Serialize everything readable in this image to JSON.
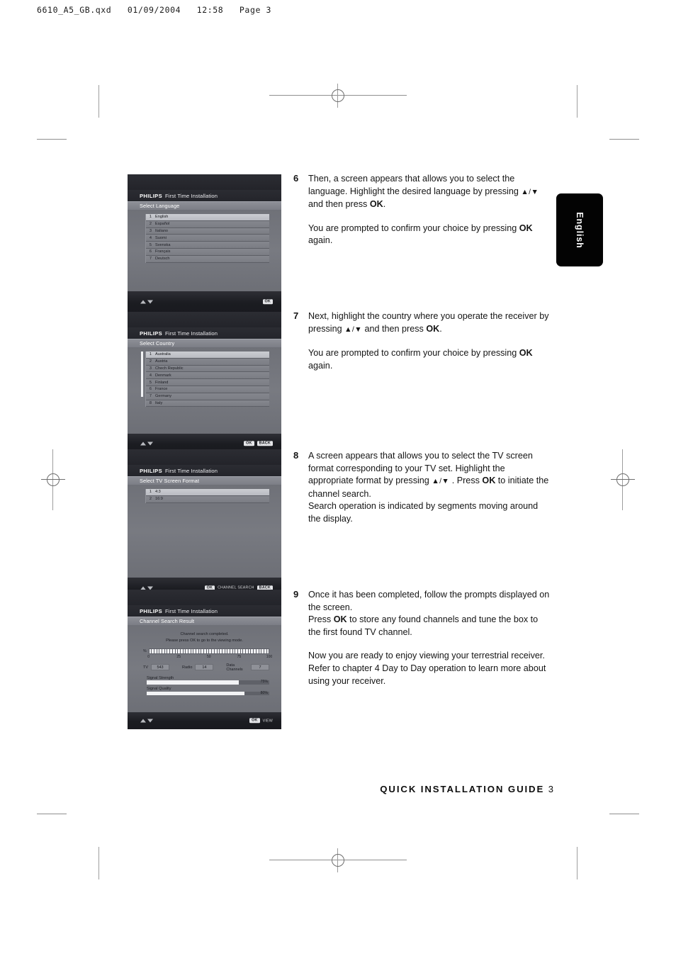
{
  "prepress": {
    "header": "6610_A5_GB.qxd   01/09/2004   12:58   Page 3"
  },
  "side_tab": {
    "label": "English"
  },
  "footer": {
    "title": "QUICK INSTALLATION GUIDE",
    "page": "3"
  },
  "brand": {
    "logo": "PHILIPS",
    "window_title": "First Time Installation"
  },
  "colors": {
    "panel_dark": "#1c1d22",
    "panel_body": "#74767d",
    "subbar": "#84868d",
    "selected_row": "#c5c7cc",
    "badge": "#e4e5e8",
    "tab_black": "#030303"
  },
  "screens": [
    {
      "name": "select-language",
      "subtitle": "Select Language",
      "selected_index": 0,
      "rows": [
        {
          "num": "1",
          "label": "English"
        },
        {
          "num": "2",
          "label": "Español"
        },
        {
          "num": "3",
          "label": "Italiano"
        },
        {
          "num": "4",
          "label": "Suomi"
        },
        {
          "num": "5",
          "label": "Svenska"
        },
        {
          "num": "6",
          "label": "Français"
        },
        {
          "num": "7",
          "label": "Deutsch"
        }
      ],
      "actions": [
        {
          "badge": "OK",
          "text": ""
        }
      ]
    },
    {
      "name": "select-country",
      "subtitle": "Select Country",
      "selected_index": 0,
      "rows": [
        {
          "num": "1",
          "label": "Australia"
        },
        {
          "num": "2",
          "label": "Austria"
        },
        {
          "num": "3",
          "label": "Chech Republic"
        },
        {
          "num": "4",
          "label": "Denmark"
        },
        {
          "num": "5",
          "label": "Finland"
        },
        {
          "num": "6",
          "label": "France"
        },
        {
          "num": "7",
          "label": "Germany"
        },
        {
          "num": "8",
          "label": "Italy"
        }
      ],
      "actions": [
        {
          "badge": "OK",
          "text": ""
        },
        {
          "badge": "BACK",
          "text": ""
        }
      ]
    },
    {
      "name": "select-tv-screen-format",
      "subtitle": "Select TV Screen Format",
      "selected_index": 0,
      "rows": [
        {
          "num": "1",
          "label": "4:3"
        },
        {
          "num": "2",
          "label": "16:9"
        }
      ],
      "actions": [
        {
          "badge": "OK",
          "text": "CHANNEL SEARCH"
        },
        {
          "badge": "BACK",
          "text": ""
        }
      ]
    }
  ],
  "search_result": {
    "name": "channel-search-result",
    "subtitle": "Channel Search Result",
    "message_line1": "Channel search completed.",
    "message_line2": "Please press OK to go to the viewing mode.",
    "progress": {
      "unit": "%",
      "value": 100,
      "segments": 46,
      "scale": [
        "0",
        "25",
        "50",
        "75",
        "100"
      ]
    },
    "counts": [
      {
        "label": "TV",
        "value": "543"
      },
      {
        "label": "Radio",
        "value": "14"
      },
      {
        "label": "Data Channels",
        "value": "7"
      }
    ],
    "signals": [
      {
        "label": "Signal Strength",
        "value": "75%",
        "percent": 75
      },
      {
        "label": "Signal Quality",
        "value": "80%",
        "percent": 80
      }
    ],
    "actions": [
      {
        "badge": "OK",
        "text": "VIEW"
      }
    ]
  },
  "steps": [
    {
      "number": "6",
      "paragraphs": [
        {
          "gap": false,
          "html": "Then, a screen appears that allows you to select the language. Highlight the desired language by pressing <span class=\"ar\">▲/▼</span> and then press <b>OK</b>."
        },
        {
          "gap": true,
          "html": "You are prompted to confirm your choice by pressing <b>OK</b> again."
        }
      ]
    },
    {
      "number": "7",
      "paragraphs": [
        {
          "gap": false,
          "html": "Next, highlight the country where you operate the receiver by pressing <span class=\"ar\">▲/▼</span> and then press <b>OK</b>."
        },
        {
          "gap": true,
          "html": "You are prompted to confirm your choice by pressing <b>OK</b> again."
        }
      ]
    },
    {
      "number": "8",
      "paragraphs": [
        {
          "gap": false,
          "html": "A screen appears that allows you to select the TV screen format corresponding to your TV set. Highlight the appropriate format by pressing <span class=\"ar\">▲/▼</span> . Press <b>OK</b> to initiate the channel search."
        },
        {
          "gap": false,
          "html": "Search operation is indicated by segments moving around the display."
        }
      ]
    },
    {
      "number": "9",
      "paragraphs": [
        {
          "gap": false,
          "html": "Once it has been completed, follow the prompts displayed on the screen."
        },
        {
          "gap": false,
          "html": "Press <b>OK</b> to store any found channels and tune the box to the first found TV channel."
        },
        {
          "gap": true,
          "html": "Now you are ready to enjoy viewing your terrestrial receiver. Refer to chapter 4 Day to Day operation to learn more about using your receiver."
        }
      ]
    }
  ]
}
